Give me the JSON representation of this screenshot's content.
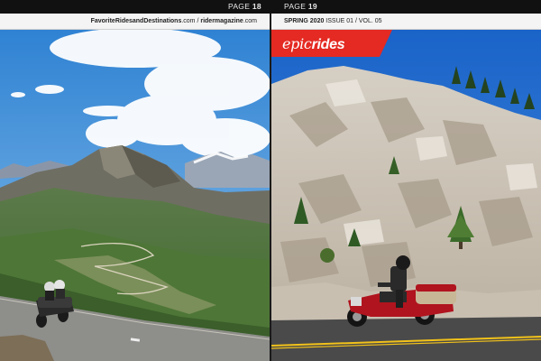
{
  "pages": {
    "left_number_label": "PAGE",
    "left_number": "18",
    "right_number_label": "PAGE",
    "right_number": "19"
  },
  "header": {
    "left_site_bold": "FavoriteRidesandDestinations",
    "left_site_suffix": ".com / ",
    "left_site2_bold": "ridermagazine",
    "left_site2_suffix": ".com",
    "right_issue_bold": "SPRING 2020",
    "right_issue_rest": " ISSUE 01 / VOL. 05"
  },
  "branding": {
    "section_prefix": "epic",
    "section_suffix": "rides",
    "accent_color": "#e42a22"
  },
  "colors": {
    "sky_left": "#3d8ed8",
    "sky_right": "#1f6fd0",
    "rock": "#d8d2c8",
    "road": "#4a4a4a",
    "road_line": "#f2c21a"
  }
}
